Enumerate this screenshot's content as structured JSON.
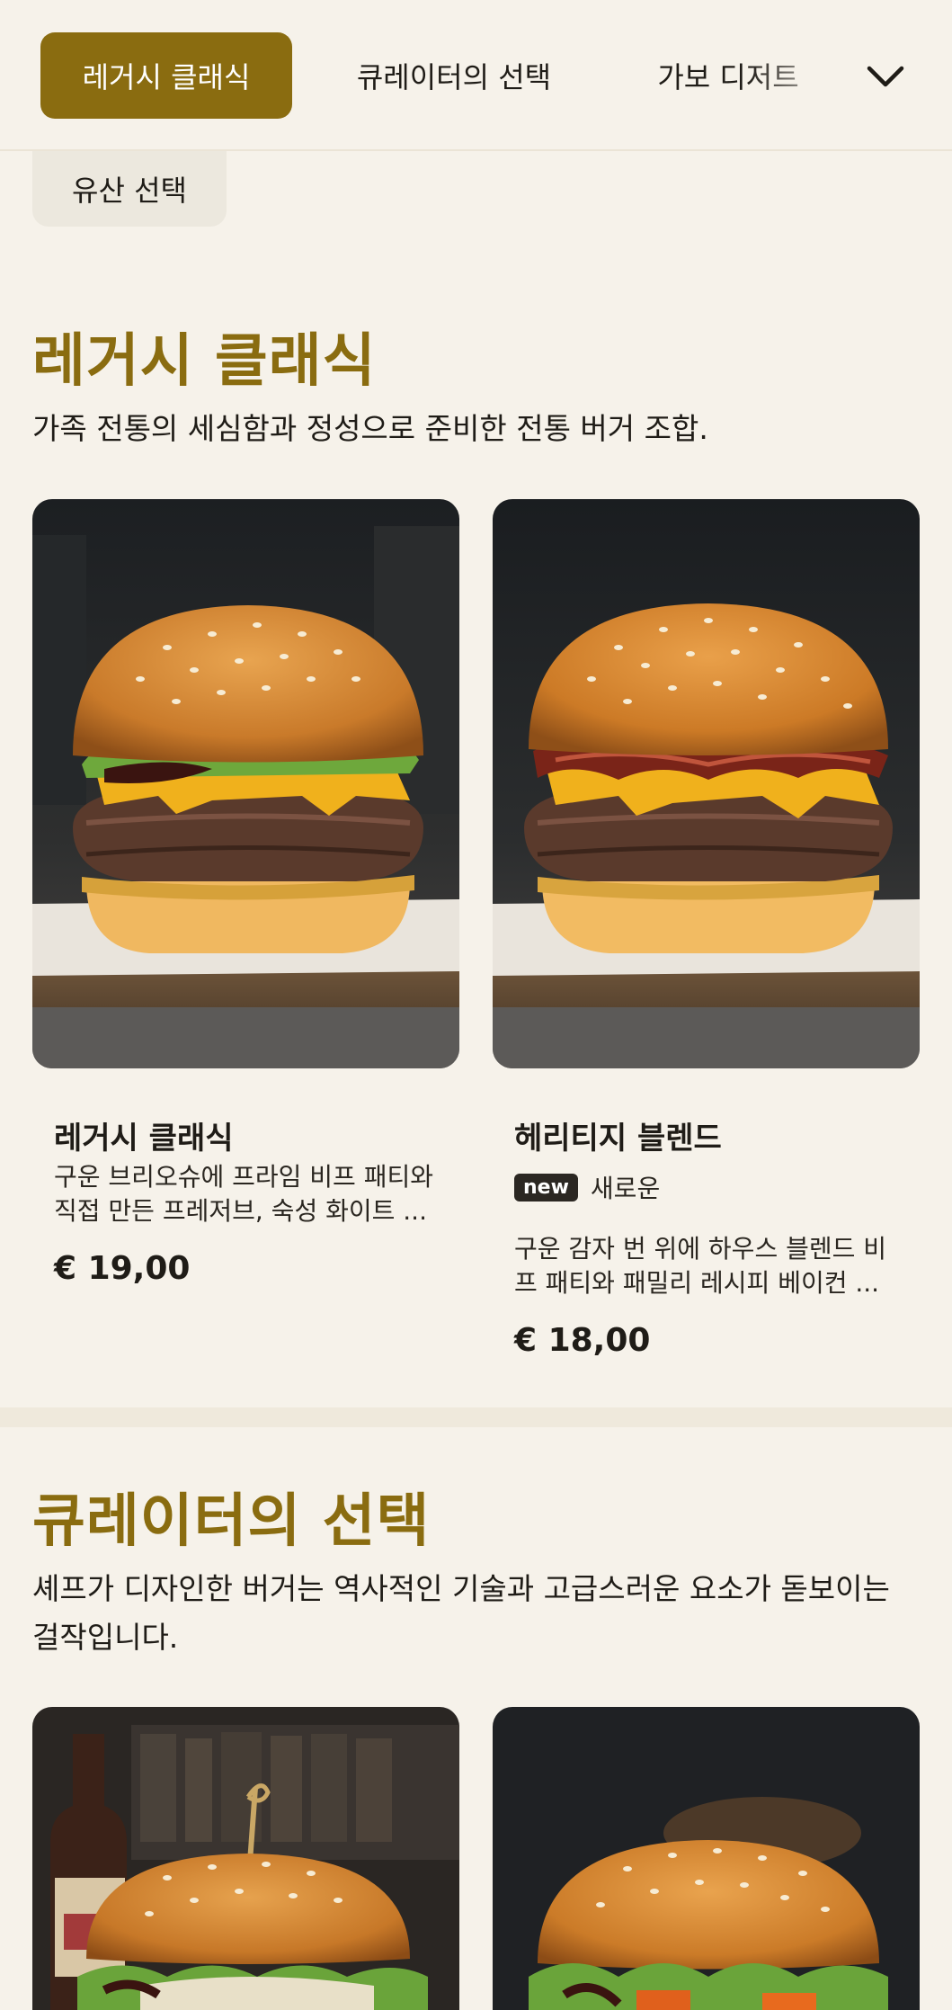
{
  "nav": {
    "tabs": [
      {
        "label": "레거시 클래식",
        "active": true
      },
      {
        "label": "큐레이터의 선택",
        "active": false
      },
      {
        "label": "가보 디저트",
        "active": false
      }
    ],
    "overflow_tab": "유산 선택",
    "expand_icon": "chevron-down-icon"
  },
  "sections": [
    {
      "title": "레거시 클래식",
      "description": "가족 전통의 세심함과 정성으로 준비한 전통 버거 조합.",
      "items": [
        {
          "name": "레거시 클래식",
          "description": "구운 브리오슈에 프라임 비프 패티와 직접 만든 프레저브, 숙성 화이트 ...",
          "price": "€ 19,00"
        },
        {
          "name": "헤리티지 블렌드",
          "badge": "new",
          "badge_text": "새로운",
          "description": "구운 감자 번 위에 하우스 블렌드 비프 패티와 패밀리 레시피 베이컨 ...",
          "price": "€ 18,00"
        }
      ]
    },
    {
      "title": "큐레이터의 선택",
      "description": "셰프가 디자인한 버거는 역사적인 기술과 고급스러운 요소가 돋보이는 걸작입니다."
    }
  ],
  "colors": {
    "accent": "#8a6c10",
    "background": "#f6f2ea",
    "text": "#1f1c17"
  }
}
